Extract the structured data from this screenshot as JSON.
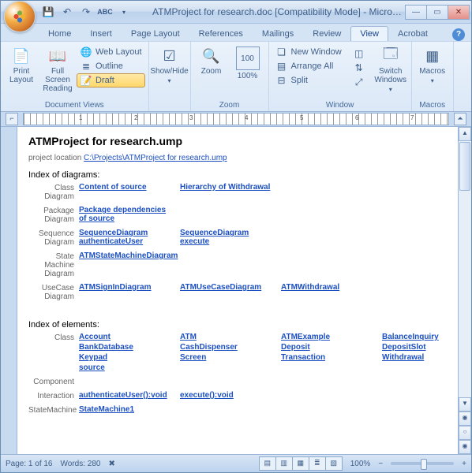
{
  "window": {
    "title": "ATMProject for research.doc [Compatibility Mode] - Microsoft Wo…"
  },
  "tabs": {
    "items": [
      "Home",
      "Insert",
      "Page Layout",
      "References",
      "Mailings",
      "Review",
      "View",
      "Acrobat"
    ],
    "active": 6
  },
  "ribbon": {
    "docviews": {
      "title": "Document Views",
      "print": "Print Layout",
      "fullscreen": "Full Screen Reading",
      "web": "Web Layout",
      "outline": "Outline",
      "draft": "Draft"
    },
    "showhide": {
      "title": "",
      "btn": "Show/Hide"
    },
    "zoom": {
      "title": "Zoom",
      "zoom": "Zoom",
      "hundred": "100%"
    },
    "windowg": {
      "title": "Window",
      "new": "New Window",
      "arrange": "Arrange All",
      "split": "Split",
      "switch": "Switch Windows"
    },
    "macros": {
      "title": "Macros",
      "btn": "Macros"
    }
  },
  "ruler_numbers": [
    "1",
    "2",
    "3",
    "4",
    "5",
    "6",
    "7"
  ],
  "doc": {
    "title": "ATMProject for research.ump",
    "loc_label": "project location",
    "loc_link": "C:\\Projects\\ATMProject for research.ump",
    "idx_diag": "Index of diagrams:",
    "idx_elem": "Index of elements:",
    "diag_rows": [
      {
        "label": "Class Diagram",
        "links": [
          "Content of source",
          "Hierarchy of Withdrawal"
        ]
      },
      {
        "label": "Package Diagram",
        "links": [
          "Package dependencies of source"
        ]
      },
      {
        "label": "Sequence Diagram",
        "links": [
          "SequenceDiagram authenticateUser",
          "SequenceDiagram execute"
        ]
      },
      {
        "label": "State Machine Diagram",
        "links": [
          "ATMStateMachineDiagram"
        ]
      },
      {
        "label": "UseCase Diagram",
        "links": [
          "ATMSignInDiagram",
          "ATMUseCaseDiagram",
          "ATMWithdrawal"
        ]
      }
    ],
    "elem_rows": [
      {
        "label": "Class",
        "links": [
          "Account",
          "ATM",
          "ATMExample",
          "BalanceInquiry",
          "BankDatabase",
          "CashDispenser",
          "Deposit",
          "DepositSlot",
          "Keypad",
          "Screen",
          "Transaction",
          "Withdrawal",
          "source"
        ]
      },
      {
        "label": "Component",
        "links": []
      },
      {
        "label": "Interaction",
        "links": [
          "authenticateUser():void",
          "execute():void"
        ]
      },
      {
        "label": "StateMachine",
        "links": [
          "StateMachine1"
        ]
      }
    ]
  },
  "status": {
    "page": "Page: 1 of 16",
    "words": "Words: 280",
    "zoom": "100%"
  }
}
